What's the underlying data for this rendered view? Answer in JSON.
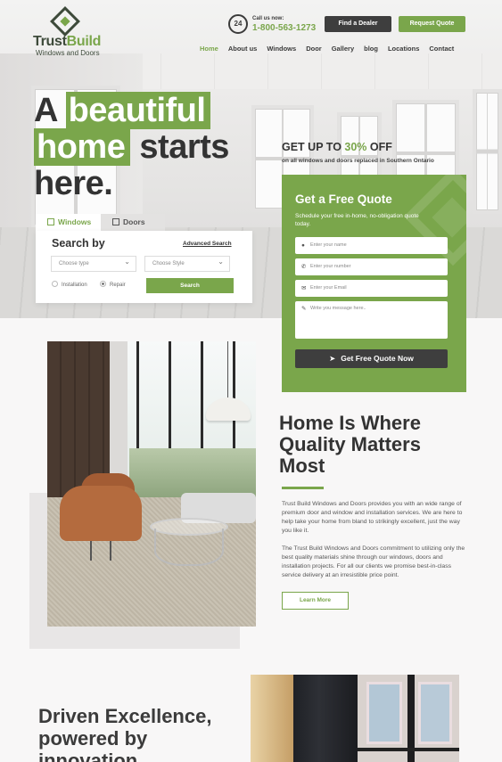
{
  "brand": {
    "name_part1": "Trust",
    "name_part2": "Build",
    "tagline": "Windows and Doors"
  },
  "contact": {
    "icon_label": "24",
    "label": "Call us now:",
    "phone": "1-800-563-1273"
  },
  "header_buttons": {
    "dealer": "Find a Dealer",
    "quote": "Request Quote"
  },
  "nav": [
    {
      "label": "Home",
      "active": true
    },
    {
      "label": "About us"
    },
    {
      "label": "Windows"
    },
    {
      "label": "Door"
    },
    {
      "label": "Gallery"
    },
    {
      "label": "blog"
    },
    {
      "label": "Locations"
    },
    {
      "label": "Contact"
    }
  ],
  "hero": {
    "line1_plain": "A ",
    "line1_hl": "beautiful",
    "line2_hl": "home",
    "line2_plain": " starts",
    "line3": "here."
  },
  "search": {
    "tabs": [
      "Windows",
      "Doors"
    ],
    "title": "Search by",
    "advanced": "Advanced Search",
    "type_placeholder": "Choose type",
    "style_placeholder": "Choose Style",
    "radio1": "Installation",
    "radio2": "Repair",
    "button": "Search"
  },
  "promo": {
    "prefix": "GET UP TO ",
    "percent": "30%",
    "suffix": " OFF",
    "sub": "on all windows and doors replaced in Southern Ontario"
  },
  "quote_form": {
    "title": "Get a Free Quote",
    "subtitle": "Schedule your free in-home, no-obligation quote today.",
    "name_placeholder": "Enter your name",
    "number_placeholder": "Enter your number",
    "email_placeholder": "Enter your Email",
    "message_placeholder": "Write you message here..",
    "button": "Get Free Quote Now"
  },
  "about": {
    "title_lines": [
      "Home Is Where",
      "Quality Matters",
      "Most"
    ],
    "para1": "Trust Build Windows and Doors provides you with an wide range of premium door and window and installation services. We are here to help take your home from bland to strikingly excellent, just the way you like it.",
    "para2": "The Trust Build Windows and Doors commitment to utilizing only the best quality materials shine through our windows, doors and installation projects. For all our clients we promise best-in-class service delivery at an irresistible price point.",
    "button": "Learn More"
  },
  "section2": {
    "title_lines": [
      "Driven Excellence,",
      "powered by",
      "innovation"
    ]
  },
  "colors": {
    "accent": "#7aa64b",
    "dark": "#3e3e3e"
  }
}
